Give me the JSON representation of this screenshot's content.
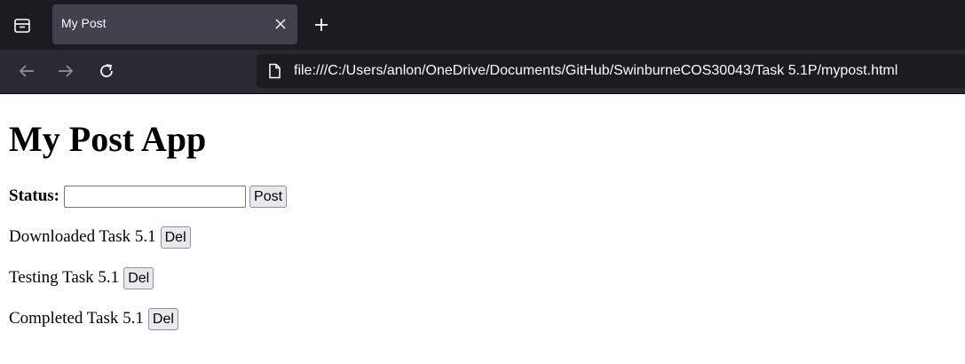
{
  "browser": {
    "tab": {
      "title": "My Post"
    },
    "url": "file:///C:/Users/anlon/OneDrive/Documents/GitHub/SwinburneCOS30043/Task 5.1P/mypost.html"
  },
  "page": {
    "title": "My Post App",
    "status_label": "Status:",
    "status_value": "",
    "post_button": "Post",
    "posts": [
      {
        "text": "Downloaded Task 5.1",
        "delete_label": "Del"
      },
      {
        "text": "Testing Task 5.1",
        "delete_label": "Del"
      },
      {
        "text": "Completed Task 5.1",
        "delete_label": "Del"
      }
    ]
  },
  "colors": {
    "tabbar_bg": "#1c1b22",
    "active_tab_bg": "#42414d",
    "navbar_bg": "#2b2a33",
    "page_bg": "#ffffff"
  }
}
